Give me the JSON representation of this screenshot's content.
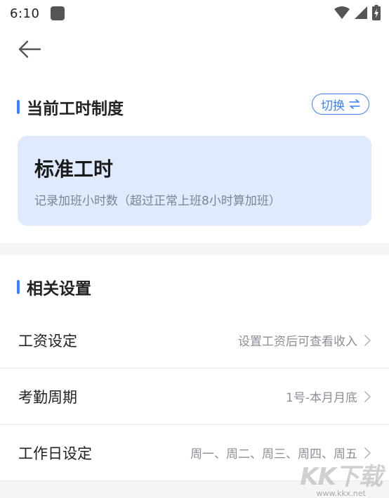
{
  "status_bar": {
    "time": "6:10"
  },
  "current_system": {
    "title": "当前工时制度",
    "switch_label": "切换",
    "card_title": "标准工时",
    "card_desc": "记录加班小时数（超过正常上班8小时算加班）"
  },
  "related_settings": {
    "title": "相关设置",
    "rows": [
      {
        "label": "工资设定",
        "value": "设置工资后可查看收入"
      },
      {
        "label": "考勤周期",
        "value": "1号-本月月底"
      },
      {
        "label": "工作日设定",
        "value": "周一、周二、周三、周四、周五"
      }
    ]
  },
  "watermark": {
    "logo": "KK下载",
    "url": "www.kkx.net"
  },
  "colors": {
    "accent": "#3b82f6",
    "card_bg": "#dfeafc",
    "divider": "#f4f5f7"
  }
}
